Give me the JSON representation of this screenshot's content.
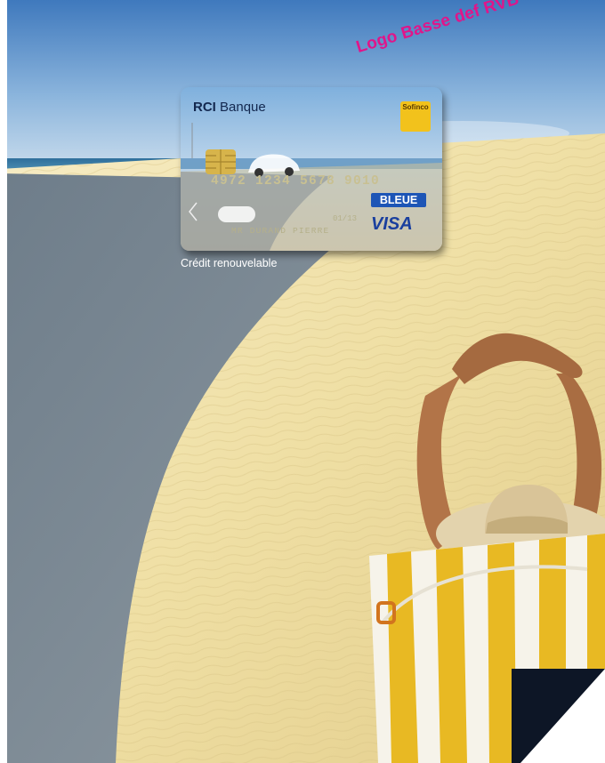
{
  "overlay": {
    "logo_placeholder": "Logo Basse def RVB",
    "caption": "Crédit renouvelable"
  },
  "card": {
    "brand_bold": "RCI",
    "brand_light": " Banque",
    "number": "4972 1234 5678 9010",
    "holder": "MR DURAND PIERRE",
    "expiry": "01/13",
    "bleue": "BLEUE",
    "visa": "VISA",
    "sofinco": "Sofinco"
  },
  "colors": {
    "sky_top": "#4f86c6",
    "sand": "#f0e1a8",
    "shadow": "#7d8892",
    "accent_magenta": "#e0158a",
    "corner_dark": "#0d1626"
  }
}
